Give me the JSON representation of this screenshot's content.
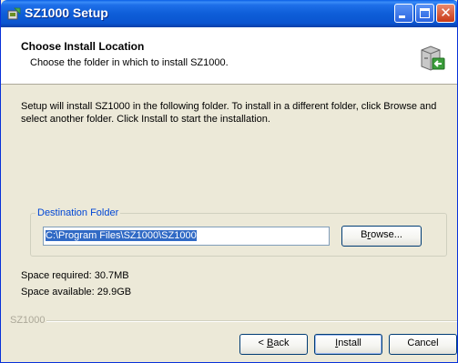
{
  "window": {
    "title": "SZ1000 Setup",
    "controls": [
      "minimize",
      "maximize",
      "close"
    ]
  },
  "header": {
    "title": "Choose Install Location",
    "subtitle": "Choose the folder in which to install SZ1000."
  },
  "intro_text": "Setup will install SZ1000 in the following folder. To install in a different folder, click Browse and select another folder. Click Install to start the installation.",
  "destination": {
    "group_label": "Destination Folder",
    "path": "C:\\Program Files\\SZ1000\\SZ1000",
    "browse_prefix": "B",
    "browse_mnemonic": "r",
    "browse_rest": "owse..."
  },
  "space": {
    "required": "Space required: 30.7MB",
    "available": "Space available: 29.9GB"
  },
  "footer": {
    "brand": "SZ1000",
    "back_prefix": "< ",
    "back_mnemonic": "B",
    "back_rest": "ack",
    "install_mnemonic": "I",
    "install_rest": "nstall",
    "cancel_label": "Cancel"
  },
  "colors": {
    "titlebar": "#0a54d0",
    "dialog_bg": "#ece9d8",
    "group_label": "#0046d5",
    "selection": "#316ac5"
  },
  "icons": {
    "title": "setup-app-icon",
    "header": "install-computer-icon"
  }
}
